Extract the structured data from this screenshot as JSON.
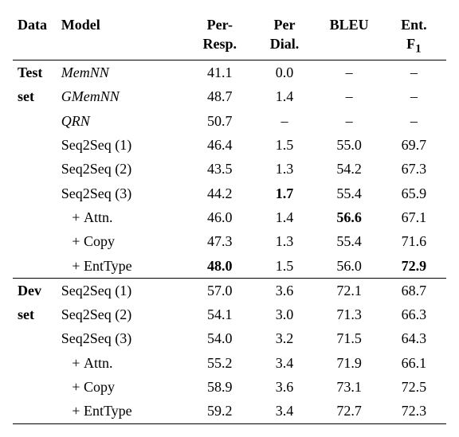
{
  "chart_data": {
    "type": "table",
    "columns": [
      "Data",
      "Model",
      "Per-Resp.",
      "Per Dial.",
      "BLEU",
      "Ent. F1"
    ],
    "sections": [
      {
        "data_label_lines": [
          "Test",
          "set"
        ],
        "rows": [
          {
            "model": "MemNN",
            "italic": true,
            "per_resp": "41.1",
            "per_dial": "0.0",
            "bleu": "–",
            "entf1": "–"
          },
          {
            "model": "GMemNN",
            "italic": true,
            "per_resp": "48.7",
            "per_dial": "1.4",
            "bleu": "–",
            "entf1": "–"
          },
          {
            "model": "QRN",
            "italic": true,
            "per_resp": "50.7",
            "per_dial": "–",
            "bleu": "–",
            "entf1": "–"
          },
          {
            "model": "Seq2Seq (1)",
            "italic": false,
            "per_resp": "46.4",
            "per_dial": "1.5",
            "bleu": "55.0",
            "entf1": "69.7"
          },
          {
            "model": "Seq2Seq (2)",
            "italic": false,
            "per_resp": "43.5",
            "per_dial": "1.3",
            "bleu": "54.2",
            "entf1": "67.3"
          },
          {
            "model": "Seq2Seq (3)",
            "italic": false,
            "per_resp": "44.2",
            "per_dial": "1.7",
            "per_dial_bold": true,
            "bleu": "55.4",
            "entf1": "65.9"
          },
          {
            "model": "   + Attn.",
            "italic": false,
            "per_resp": "46.0",
            "per_dial": "1.4",
            "bleu": "56.6",
            "bleu_bold": true,
            "entf1": "67.1"
          },
          {
            "model": "   + Copy",
            "italic": false,
            "per_resp": "47.3",
            "per_dial": "1.3",
            "bleu": "55.4",
            "entf1": "71.6"
          },
          {
            "model": "   + EntType",
            "italic": false,
            "per_resp": "48.0",
            "per_resp_bold": true,
            "per_dial": "1.5",
            "bleu": "56.0",
            "entf1": "72.9",
            "entf1_bold": true
          }
        ]
      },
      {
        "data_label_lines": [
          "Dev",
          "set"
        ],
        "rows": [
          {
            "model": "Seq2Seq (1)",
            "italic": false,
            "per_resp": "57.0",
            "per_dial": "3.6",
            "bleu": "72.1",
            "entf1": "68.7"
          },
          {
            "model": "Seq2Seq (2)",
            "italic": false,
            "per_resp": "54.1",
            "per_dial": "3.0",
            "bleu": "71.3",
            "entf1": "66.3"
          },
          {
            "model": "Seq2Seq (3)",
            "italic": false,
            "per_resp": "54.0",
            "per_dial": "3.2",
            "bleu": "71.5",
            "entf1": "64.3"
          },
          {
            "model": "   + Attn.",
            "italic": false,
            "per_resp": "55.2",
            "per_dial": "3.4",
            "bleu": "71.9",
            "entf1": "66.1"
          },
          {
            "model": "   + Copy",
            "italic": false,
            "per_resp": "58.9",
            "per_dial": "3.6",
            "bleu": "73.1",
            "entf1": "72.5"
          },
          {
            "model": "   + EntType",
            "italic": false,
            "per_resp": "59.2",
            "per_dial": "3.4",
            "bleu": "72.7",
            "entf1": "72.3"
          }
        ]
      }
    ]
  },
  "header": {
    "data": "Data",
    "model": "Model",
    "per_resp_l1": "Per-",
    "per_resp_l2": "Resp.",
    "per_dial_l1": "Per",
    "per_dial_l2": "Dial.",
    "bleu": "BLEU",
    "entf1_l1": "Ent.",
    "entf1_l2": "F",
    "entf1_sub": "1"
  }
}
